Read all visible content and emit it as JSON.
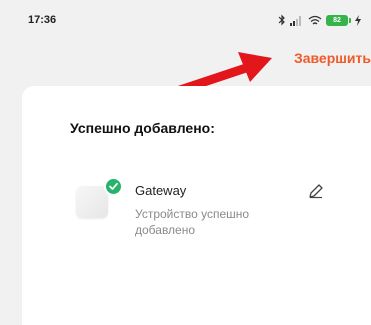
{
  "status_bar": {
    "time": "17:36",
    "battery_level": "82",
    "icons": [
      "bluetooth-icon",
      "signal-icon",
      "wifi-icon",
      "battery-icon",
      "charging-icon"
    ]
  },
  "header": {
    "finish_label": "Завершить",
    "accent_color": "#f05a28",
    "annotation_arrow_color": "#e3161b"
  },
  "card": {
    "title": "Успешно добавлено:",
    "device": {
      "name": "Gateway",
      "status": "Устройство успешно добавлено",
      "icon": "gateway-device-icon",
      "badge_color": "#27b36b"
    }
  }
}
